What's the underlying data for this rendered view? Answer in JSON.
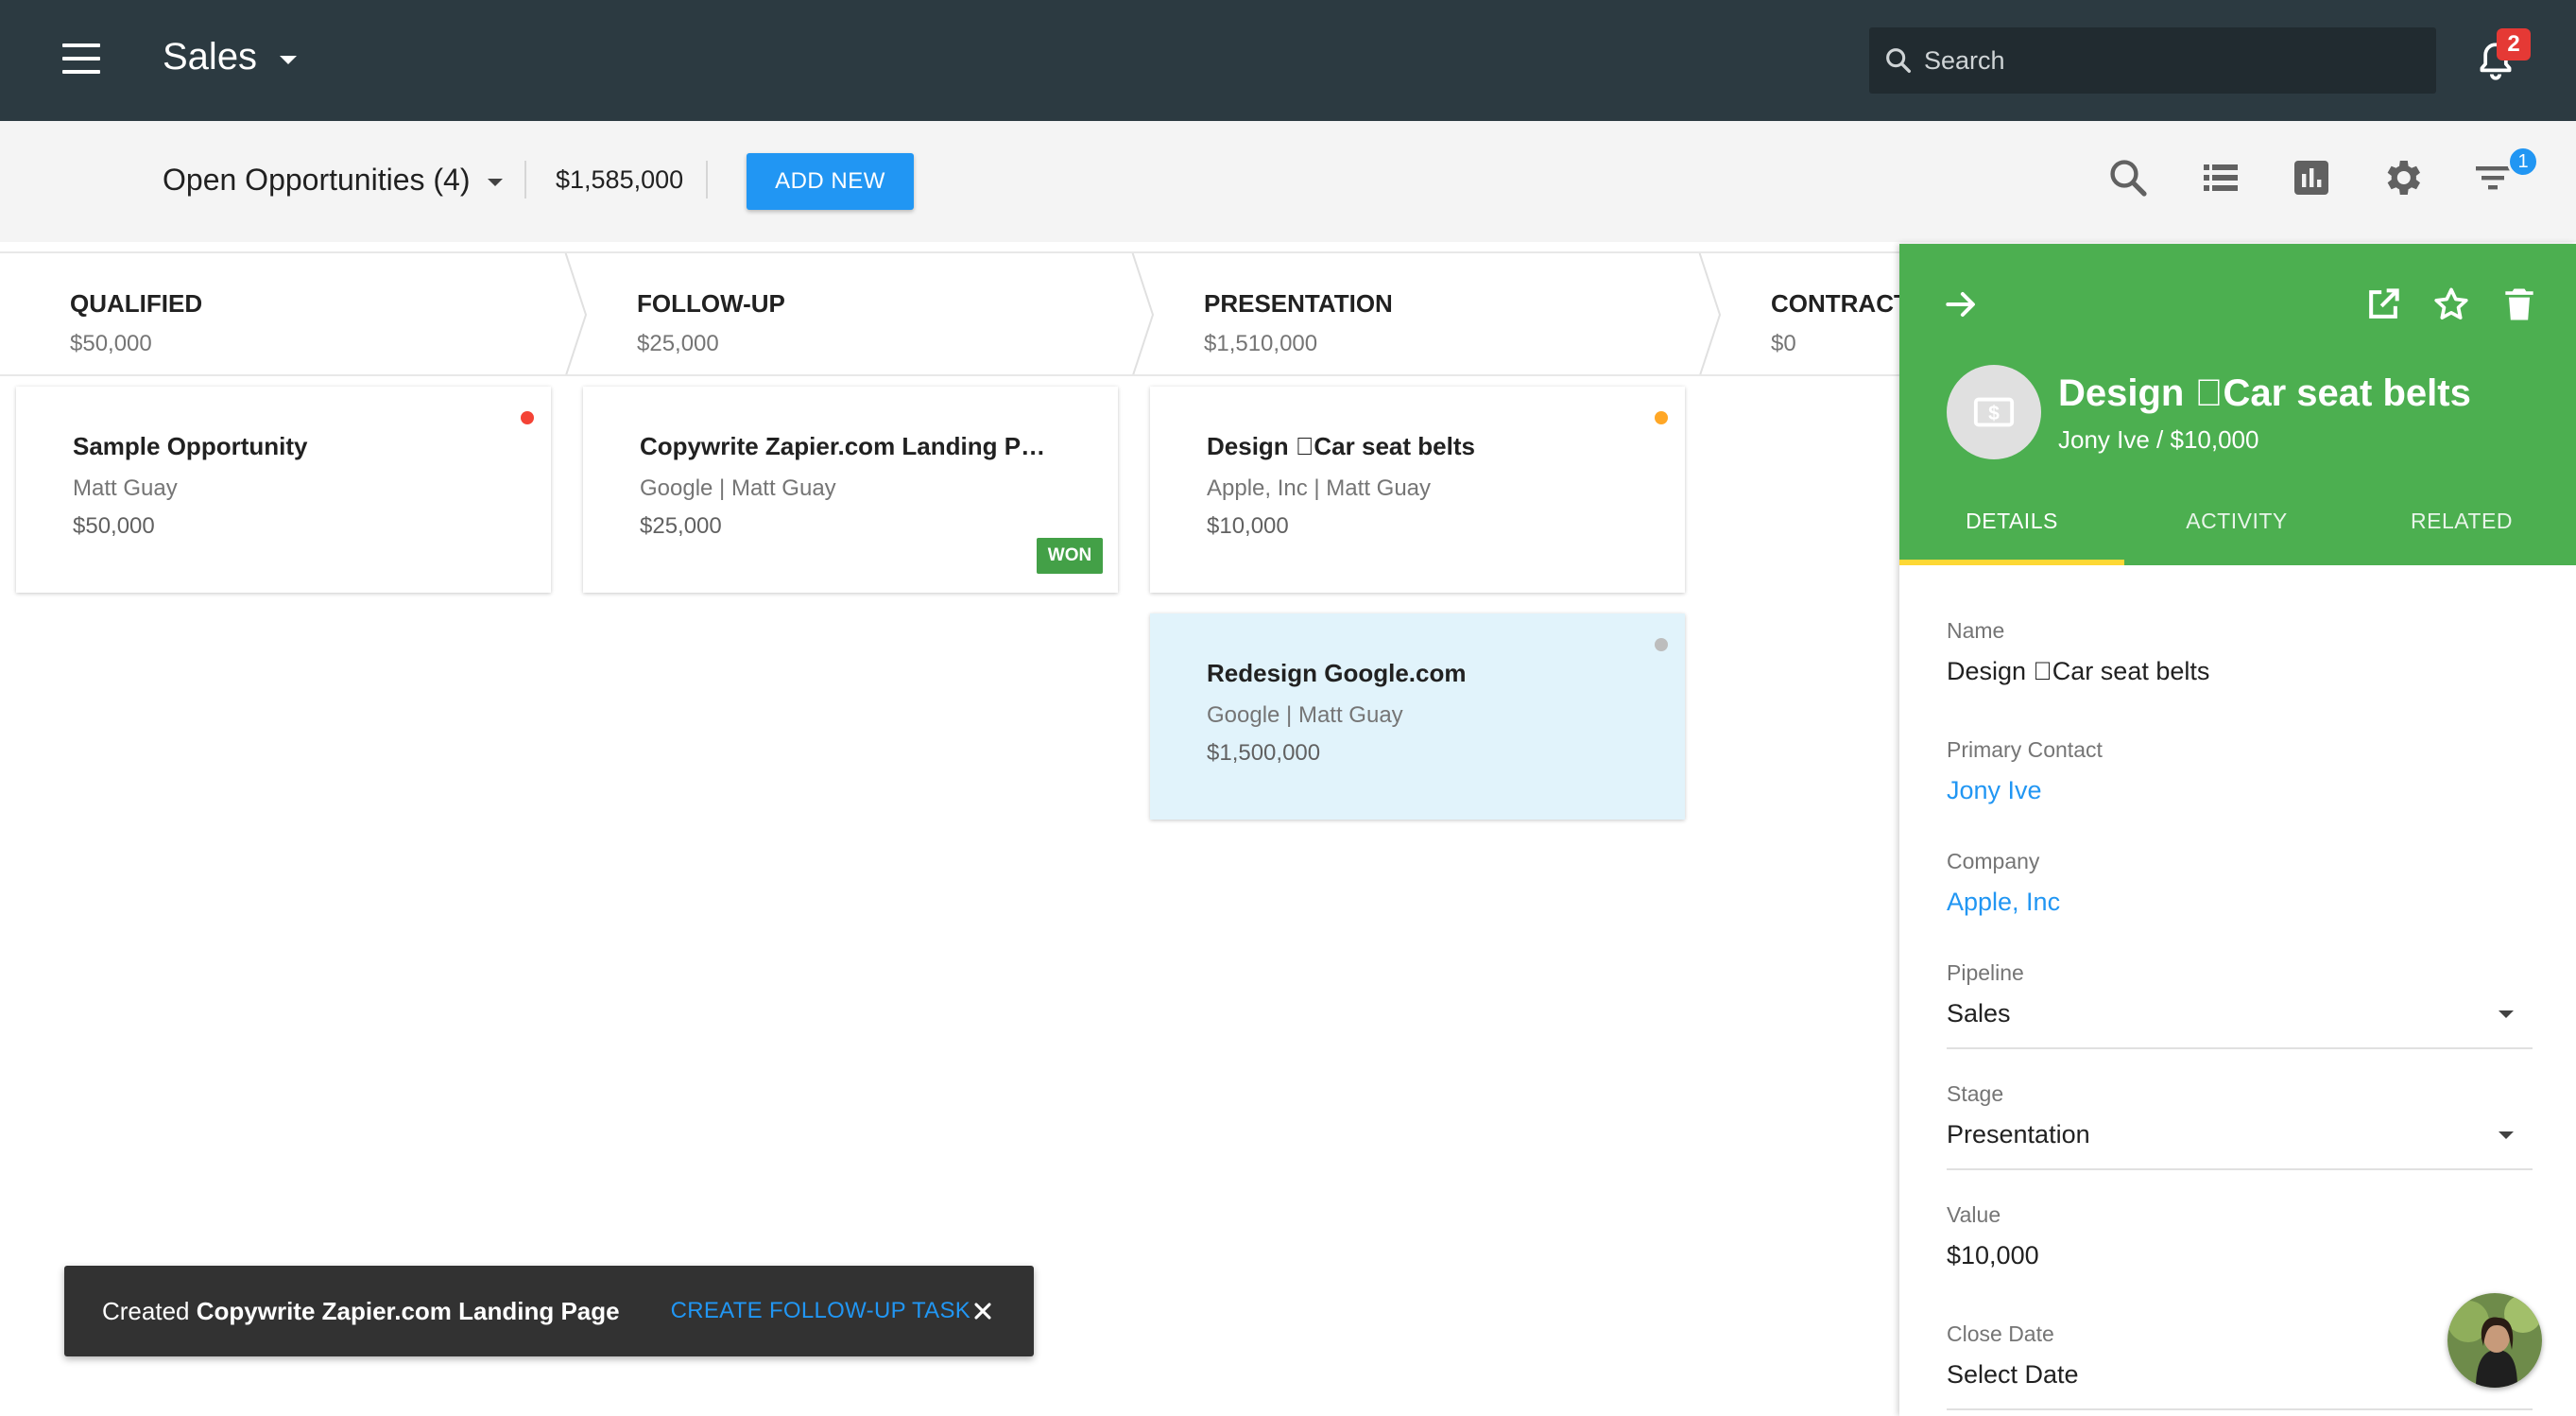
{
  "topbar": {
    "app_name": "Sales",
    "search_placeholder": "Search",
    "notification_count": "2"
  },
  "toolbar": {
    "view_name": "Open Opportunities (4)",
    "total_value": "$1,585,000",
    "add_new_label": "ADD NEW",
    "filter_count": "1"
  },
  "stages": [
    {
      "name": "QUALIFIED",
      "amount": "$50,000"
    },
    {
      "name": "FOLLOW-UP",
      "amount": "$25,000"
    },
    {
      "name": "PRESENTATION",
      "amount": "$1,510,000"
    },
    {
      "name": "CONTRACT",
      "amount": "$0"
    }
  ],
  "cards": [
    {
      "title": "Sample Opportunity",
      "subtitle": "Matt Guay",
      "amount": "$50,000",
      "dot_color": "#f44336"
    },
    {
      "title": "Copywrite Zapier.com Landing P…",
      "subtitle": "Google | Matt Guay",
      "amount": "$25,000",
      "badge": "WON"
    },
    {
      "title": "Design Car seat belts",
      "subtitle": "Apple, Inc | Matt Guay",
      "amount": "$10,000",
      "dot_color": "#ffa726"
    },
    {
      "title": "Redesign Google.com",
      "subtitle": "Google | Matt Guay",
      "amount": "$1,500,000",
      "dot_color": "#bdbdbd"
    }
  ],
  "detail": {
    "title": "Design Car seat belts",
    "subtitle": "Jony Ive / $10,000",
    "header_color": "#4caf50",
    "tabs": [
      "DETAILS",
      "ACTIVITY",
      "RELATED"
    ],
    "active_tab": "DETAILS",
    "fields": {
      "name": {
        "label": "Name",
        "value": "Design Car seat belts"
      },
      "primary_contact": {
        "label": "Primary Contact",
        "value": "Jony Ive"
      },
      "company": {
        "label": "Company",
        "value": "Apple, Inc"
      },
      "pipeline": {
        "label": "Pipeline",
        "value": "Sales"
      },
      "stage": {
        "label": "Stage",
        "value": "Presentation"
      },
      "value": {
        "label": "Value",
        "value": "$10,000"
      },
      "close_date": {
        "label": "Close Date",
        "value": "Select Date"
      }
    }
  },
  "snackbar": {
    "prefix": "Created",
    "item": "Copywrite Zapier.com Landing Page",
    "action": "CREATE FOLLOW-UP TASK"
  },
  "icons": [
    "menu-icon",
    "search-icon",
    "bell-icon",
    "list-icon",
    "chart-icon",
    "gear-icon",
    "filter-icon",
    "arrow-right-icon",
    "open-in-new-icon",
    "star-icon",
    "delete-icon",
    "money-icon",
    "close-icon"
  ]
}
